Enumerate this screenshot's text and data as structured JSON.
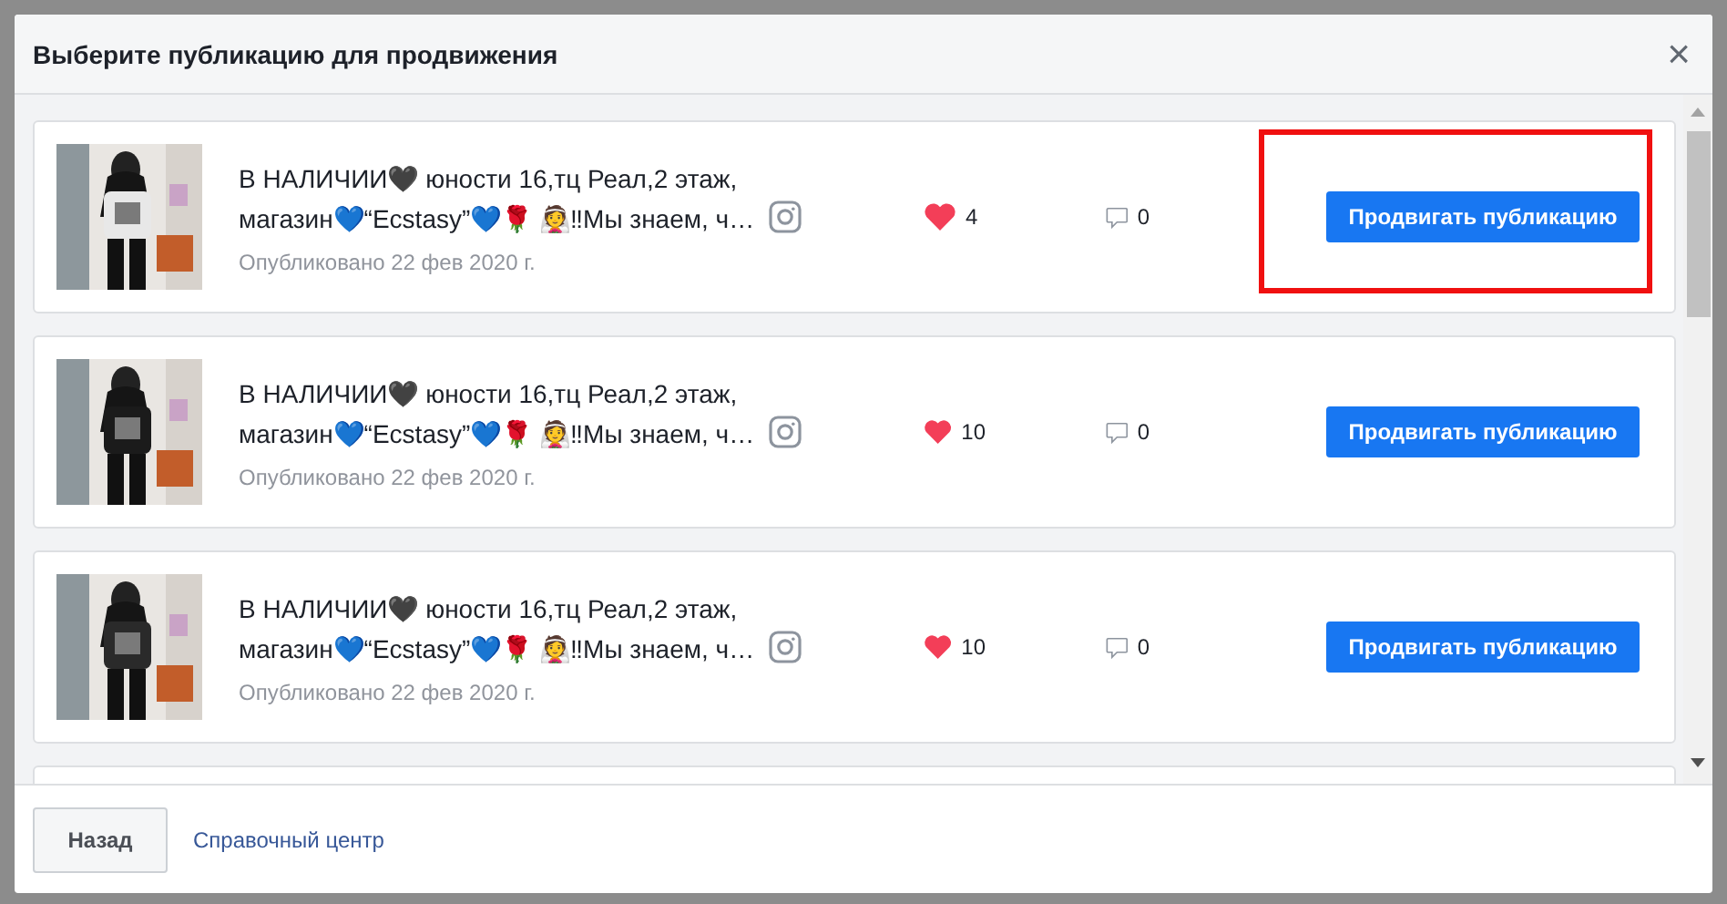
{
  "dialog": {
    "title": "Выберите публикацию для продвижения",
    "close": "×"
  },
  "posts": [
    {
      "line_1": "В НАЛИЧИИ🖤 юности 16,тц Реал,2 этаж,",
      "line_2": "магазин💙“Ecstasy”💙🌹 👰‼Мы знаем, ч…",
      "date": "Опубликовано 22 фев 2020 г.",
      "likes": "4",
      "comments": "0",
      "button": "Продвигать публикацию",
      "highlighted": true
    },
    {
      "line_1": "В НАЛИЧИИ🖤 юности 16,тц Реал,2 этаж,",
      "line_2": "магазин💙“Ecstasy”💙🌹 👰‼Мы знаем, ч…",
      "date": "Опубликовано 22 фев 2020 г.",
      "likes": "10",
      "comments": "0",
      "button": "Продвигать публикацию",
      "highlighted": false
    },
    {
      "line_1": "В НАЛИЧИИ🖤 юности 16,тц Реал,2 этаж,",
      "line_2": "магазин💙“Ecstasy”💙🌹 👰‼Мы знаем, ч…",
      "date": "Опубликовано 22 фев 2020 г.",
      "likes": "10",
      "comments": "0",
      "button": "Продвигать публикацию",
      "highlighted": false
    }
  ],
  "footer": {
    "back_button": "Назад",
    "help_link": "Справочный центр"
  }
}
